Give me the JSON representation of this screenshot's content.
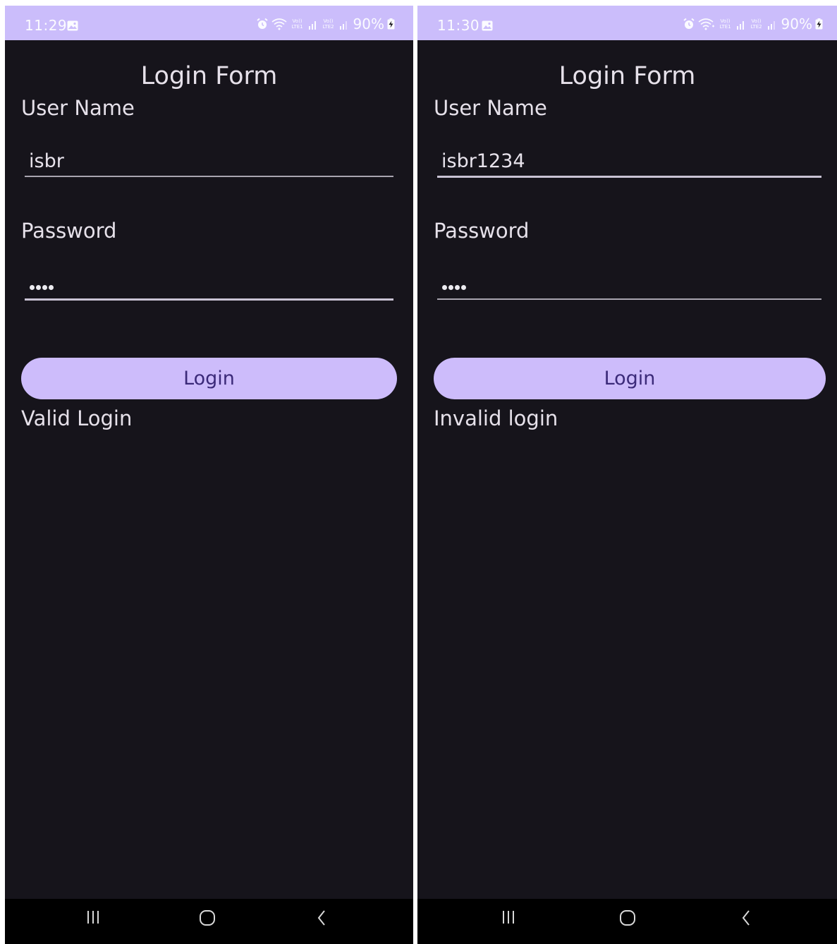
{
  "screens": [
    {
      "status_bar": {
        "time": "11:29",
        "battery": "90%",
        "volte1": "Vo)) LTE1",
        "volte2": "Vo)) LTE2"
      },
      "title": "Login Form",
      "username": {
        "label": "User Name",
        "value": "isbr"
      },
      "password": {
        "label": "Password",
        "masked": "••••"
      },
      "login_label": "Login",
      "result": "Valid Login"
    },
    {
      "status_bar": {
        "time": "11:30",
        "battery": "90%",
        "volte1": "Vo)) LTE1",
        "volte2": "Vo)) LTE2"
      },
      "title": "Login Form",
      "username": {
        "label": "User Name",
        "value": "isbr1234"
      },
      "password": {
        "label": "Password",
        "masked": "••••"
      },
      "login_label": "Login",
      "result": "Invalid login"
    }
  ],
  "icons": {
    "status": [
      "gallery-icon",
      "alarm-icon",
      "wifi-icon",
      "signal-icon",
      "battery-charging-icon"
    ],
    "nav": [
      "recents-icon",
      "home-icon",
      "back-icon"
    ]
  },
  "colors": {
    "status_bar": "#cbbdfb",
    "background": "#16141b",
    "button": "#cdbcfb",
    "button_text": "#3b2a79",
    "text": "#e6e1ea",
    "nav_bar": "#000000"
  }
}
